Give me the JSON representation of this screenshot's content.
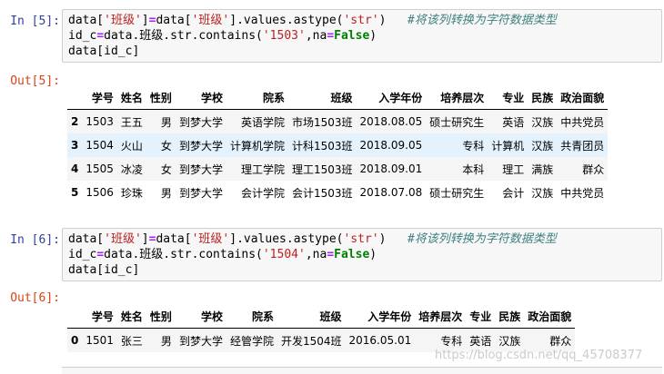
{
  "cells": [
    {
      "in_prompt": "In [5]:",
      "out_prompt": "Out[5]:",
      "code": [
        [
          {
            "t": "data["
          },
          {
            "t": "'班级'",
            "c": "str"
          },
          {
            "t": "]"
          },
          {
            "t": "=",
            "c": "op"
          },
          {
            "t": "data["
          },
          {
            "t": "'班级'",
            "c": "str"
          },
          {
            "t": "].values.astype("
          },
          {
            "t": "'str'",
            "c": "str"
          },
          {
            "t": ")   "
          },
          {
            "t": "#将该列转换为字符数据类型",
            "c": "cmt"
          }
        ],
        [
          {
            "t": "id_c"
          },
          {
            "t": "=",
            "c": "op"
          },
          {
            "t": "data.班级.str.contains("
          },
          {
            "t": "'1503'",
            "c": "str"
          },
          {
            "t": ",na"
          },
          {
            "t": "=",
            "c": "op"
          },
          {
            "t": "False",
            "c": "kw"
          },
          {
            "t": ")"
          }
        ],
        [
          {
            "t": "data[id_c]"
          }
        ]
      ],
      "table": {
        "columns": [
          "学号",
          "姓名",
          "性别",
          "学校",
          "院系",
          "班级",
          "入学年份",
          "培养层次",
          "专业",
          "民族",
          "政治面貌"
        ],
        "rows": [
          {
            "index": "2",
            "cells": [
              "1503",
              "王五",
              "男",
              "到梦大学",
              "英语学院",
              "市场1503班",
              "2018.08.05",
              "硕士研究生",
              "英语",
              "汉族",
              "中共党员"
            ]
          },
          {
            "index": "3",
            "cells": [
              "1504",
              "火山",
              "女",
              "到梦大学",
              "计算机学院",
              "计科1503班",
              "2018.09.05",
              "专科",
              "计算机",
              "汉族",
              "共青团员"
            ]
          },
          {
            "index": "4",
            "cells": [
              "1505",
              "冰凌",
              "女",
              "到梦大学",
              "理工学院",
              "理工1503班",
              "2018.09.01",
              "本科",
              "理工",
              "满族",
              "群众"
            ]
          },
          {
            "index": "5",
            "cells": [
              "1506",
              "珍珠",
              "男",
              "到梦大学",
              "会计学院",
              "会计1503班",
              "2018.07.08",
              "硕士研究生",
              "会计",
              "汉族",
              "中共党员"
            ]
          }
        ]
      }
    },
    {
      "in_prompt": "In [6]:",
      "out_prompt": "Out[6]:",
      "code": [
        [
          {
            "t": "data["
          },
          {
            "t": "'班级'",
            "c": "str"
          },
          {
            "t": "]"
          },
          {
            "t": "=",
            "c": "op"
          },
          {
            "t": "data["
          },
          {
            "t": "'班级'",
            "c": "str"
          },
          {
            "t": "].values.astype("
          },
          {
            "t": "'str'",
            "c": "str"
          },
          {
            "t": ")   "
          },
          {
            "t": "#将该列转换为字符数据类型",
            "c": "cmt"
          }
        ],
        [
          {
            "t": "id_c"
          },
          {
            "t": "=",
            "c": "op"
          },
          {
            "t": "data.班级.str.contains("
          },
          {
            "t": "'1504'",
            "c": "str"
          },
          {
            "t": ",na"
          },
          {
            "t": "=",
            "c": "op"
          },
          {
            "t": "False",
            "c": "kw"
          },
          {
            "t": ")"
          }
        ],
        [
          {
            "t": "data[id_c]"
          }
        ]
      ],
      "table": {
        "columns": [
          "学号",
          "姓名",
          "性别",
          "学校",
          "院系",
          "班级",
          "入学年份",
          "培养层次",
          "专业",
          "民族",
          "政治面貌"
        ],
        "rows": [
          {
            "index": "0",
            "cells": [
              "1501",
              "张三",
              "男",
              "到梦大学",
              "经管学院",
              "开发1504班",
              "2016.05.01",
              "专科",
              "英语",
              "汉族",
              "群众"
            ]
          }
        ]
      }
    }
  ],
  "watermark": "https://blog.csdn.net/qq_45708377"
}
